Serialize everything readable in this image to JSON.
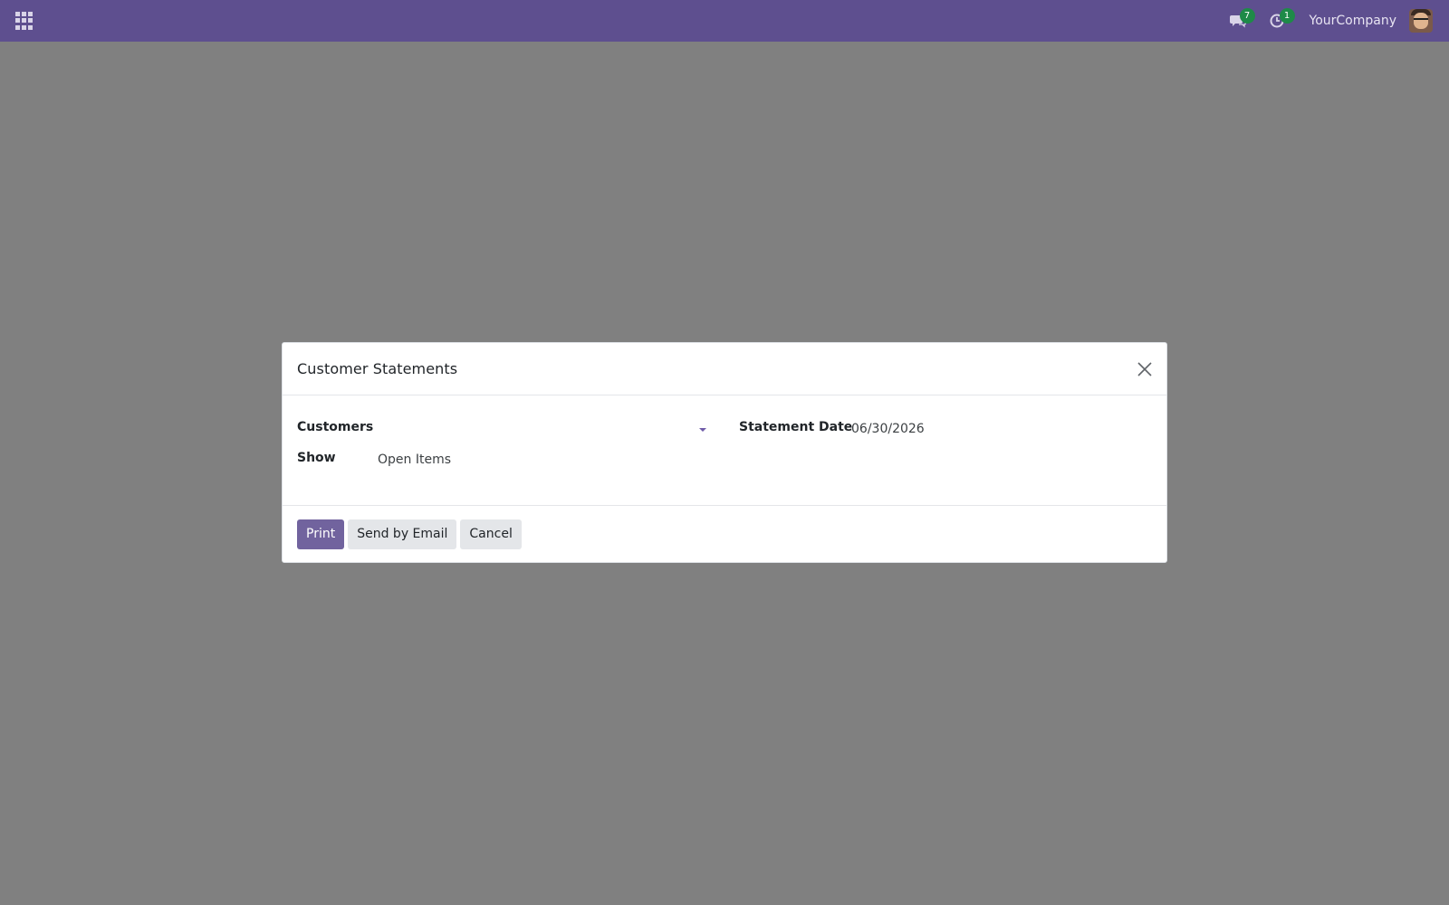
{
  "navbar": {
    "messages_badge": "7",
    "activities_badge": "1",
    "company": "YourCompany"
  },
  "dialog": {
    "title": "Customer Statements",
    "fields": {
      "customers_label": "Customers",
      "customers_value": "",
      "show_label": "Show",
      "show_value": "Open Items",
      "statement_date_label": "Statement Date",
      "statement_date_value": "06/30/2026"
    },
    "buttons": {
      "print": "Print",
      "send_email": "Send by Email",
      "cancel": "Cancel"
    }
  },
  "colors": {
    "navbar": "#5e4f8f",
    "primary": "#71639e",
    "badge": "#1e8a48",
    "overlay": "#808080"
  }
}
